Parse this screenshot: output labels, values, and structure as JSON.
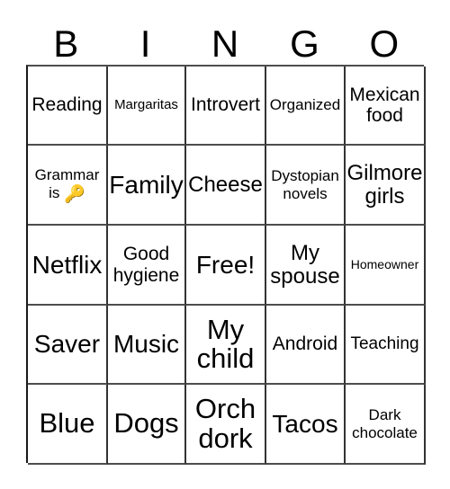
{
  "card": {
    "title": "BINGO",
    "header_letters": [
      "B",
      "I",
      "N",
      "G",
      "O"
    ],
    "grid": {
      "rows": 5,
      "columns": 5,
      "free_space": "Free!",
      "cells": [
        [
          {
            "text": "Reading",
            "size": "ml"
          },
          {
            "text": "Margaritas",
            "size": "s"
          },
          {
            "text": "Introvert",
            "size": "ml"
          },
          {
            "text": "Organized",
            "size": "sm"
          },
          {
            "text": "Mexican food",
            "size": "ml"
          }
        ],
        [
          {
            "text": "Grammar is",
            "size": "sm",
            "emoji": "key-emoji",
            "emoji_glyph": "🔑"
          },
          {
            "text": "Family",
            "size": "xl"
          },
          {
            "text": "Cheese",
            "size": "l"
          },
          {
            "text": "Dystopian novels",
            "size": "sm"
          },
          {
            "text": "Gilmore girls",
            "size": "l"
          }
        ],
        [
          {
            "text": "Netflix",
            "size": "xl"
          },
          {
            "text": "Good hygiene",
            "size": "ml"
          },
          {
            "text": "Free!",
            "size": "xl"
          },
          {
            "text": "My spouse",
            "size": "l"
          },
          {
            "text": "Homeowner",
            "size": "xs"
          }
        ],
        [
          {
            "text": "Saver",
            "size": "xl"
          },
          {
            "text": "Music",
            "size": "xl"
          },
          {
            "text": "My child",
            "size": "xxl"
          },
          {
            "text": "Android",
            "size": "ml"
          },
          {
            "text": "Teaching",
            "size": "m"
          }
        ],
        [
          {
            "text": "Blue",
            "size": "xxl"
          },
          {
            "text": "Dogs",
            "size": "xxl"
          },
          {
            "text": "Orch dork",
            "size": "xxl"
          },
          {
            "text": "Tacos",
            "size": "xl"
          },
          {
            "text": "Dark chocolate",
            "size": "sm"
          }
        ]
      ]
    },
    "colors": {
      "background": "#ffffff",
      "text": "#000000",
      "grid_line": "#333333",
      "key_emoji_gold": "#f5c542"
    }
  }
}
